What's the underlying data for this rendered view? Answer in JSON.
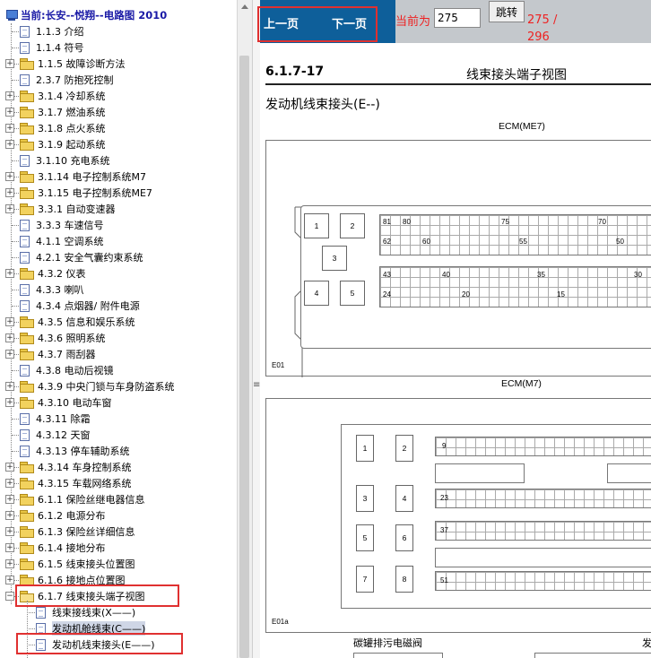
{
  "tree": {
    "title": "当前:长安--悦翔--电路图 2010",
    "items": [
      {
        "label": "1.1.3 介绍",
        "type": "doc"
      },
      {
        "label": "1.1.4 符号",
        "type": "doc"
      },
      {
        "label": "1.1.5 故障诊断方法",
        "type": "folder"
      },
      {
        "label": "2.3.7 防抱死控制",
        "type": "doc"
      },
      {
        "label": "3.1.4 冷却系统",
        "type": "folder"
      },
      {
        "label": "3.1.7 燃油系统",
        "type": "folder"
      },
      {
        "label": "3.1.8 点火系统",
        "type": "folder"
      },
      {
        "label": "3.1.9 起动系统",
        "type": "folder"
      },
      {
        "label": "3.1.10 充电系统",
        "type": "doc"
      },
      {
        "label": "3.1.14 电子控制系统M7",
        "type": "folder"
      },
      {
        "label": "3.1.15 电子控制系统ME7",
        "type": "folder"
      },
      {
        "label": "3.3.1 自动变速器",
        "type": "folder"
      },
      {
        "label": "3.3.3 车速信号",
        "type": "doc"
      },
      {
        "label": "4.1.1 空调系统",
        "type": "doc"
      },
      {
        "label": "4.2.1 安全气囊约束系统",
        "type": "doc"
      },
      {
        "label": "4.3.2 仪表",
        "type": "folder"
      },
      {
        "label": "4.3.3 喇叭",
        "type": "doc"
      },
      {
        "label": "4.3.4 点烟器/ 附件电源",
        "type": "doc"
      },
      {
        "label": "4.3.5 信息和娱乐系统",
        "type": "folder"
      },
      {
        "label": "4.3.6 照明系统",
        "type": "folder"
      },
      {
        "label": "4.3.7 雨刮器",
        "type": "folder"
      },
      {
        "label": "4.3.8 电动后视镜",
        "type": "doc"
      },
      {
        "label": "4.3.9 中央门锁与车身防盗系统",
        "type": "folder"
      },
      {
        "label": "4.3.10 电动车窗",
        "type": "folder"
      },
      {
        "label": "4.3.11 除霜",
        "type": "doc"
      },
      {
        "label": "4.3.12 天窗",
        "type": "doc"
      },
      {
        "label": "4.3.13 停车辅助系统",
        "type": "doc"
      },
      {
        "label": "4.3.14 车身控制系统",
        "type": "folder"
      },
      {
        "label": "4.3.15 车载网络系统",
        "type": "folder"
      },
      {
        "label": "6.1.1 保险丝继电器信息",
        "type": "folder"
      },
      {
        "label": "6.1.2 电源分布",
        "type": "folder"
      },
      {
        "label": "6.1.3 保险丝详细信息",
        "type": "folder"
      },
      {
        "label": "6.1.4 接地分布",
        "type": "folder"
      },
      {
        "label": "6.1.5 线束接头位置图",
        "type": "folder"
      },
      {
        "label": "6.1.6 接地点位置图",
        "type": "folder"
      },
      {
        "label": "6.1.7 线束接头端子视图",
        "type": "folder-open"
      },
      {
        "label": "线束接线束(X——)",
        "type": "child"
      },
      {
        "label": "发动机舱线束(C——)",
        "type": "child-selected"
      },
      {
        "label": "发动机线束接头(E——)",
        "type": "child"
      }
    ]
  },
  "toolbar": {
    "prev": "上一页",
    "next": "下一页",
    "current_label": "当前为",
    "page_value": "275",
    "goto": "跳转",
    "page_total": "275 / 296"
  },
  "doc": {
    "number": "6.1.7-17",
    "title": "线束接头端子视图",
    "section": "发动机线束接头(E--)",
    "connector1": {
      "label": "ECM(ME7)",
      "id": "E01",
      "pins_left": [
        "1",
        "2",
        "3",
        "4",
        "5"
      ],
      "pins_top": [
        "81",
        "80",
        "75",
        "70"
      ],
      "pins_row2": [
        "62",
        "60",
        "55",
        "50"
      ],
      "pins_row3": [
        "43",
        "40",
        "35",
        "30"
      ],
      "pins_row4": [
        "24",
        "20",
        "15"
      ]
    },
    "connector2": {
      "label": "ECM(M7)",
      "id": "E01a",
      "pins_left": [
        "1",
        "2",
        "3",
        "4",
        "5",
        "6",
        "7",
        "8"
      ],
      "pins_rows": [
        "9",
        "23",
        "37",
        "51"
      ]
    },
    "footer_left": "碳罐排污电磁阀",
    "footer_right": "发"
  }
}
